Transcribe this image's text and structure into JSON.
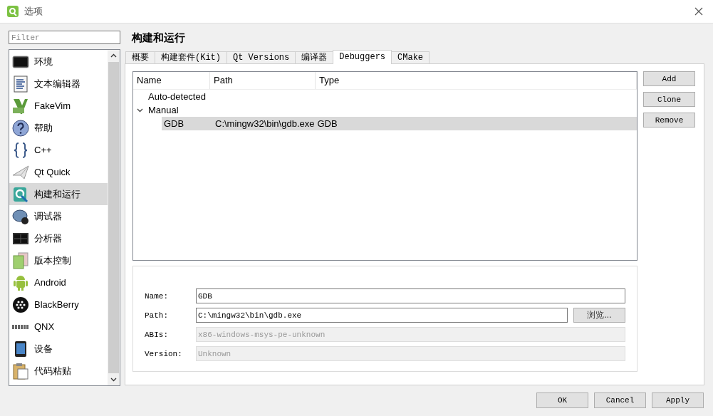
{
  "window": {
    "title": "选项"
  },
  "filter": {
    "placeholder": "Filter"
  },
  "sidebar": {
    "items": [
      {
        "label": "环境",
        "kind": "monitor",
        "selected": false
      },
      {
        "label": "文本编辑器",
        "kind": "document",
        "selected": false
      },
      {
        "label": "FakeVim",
        "kind": "vim",
        "selected": false
      },
      {
        "label": "帮助",
        "kind": "help",
        "selected": false
      },
      {
        "label": "C++",
        "kind": "braces",
        "selected": false
      },
      {
        "label": "Qt Quick",
        "kind": "plane",
        "selected": false
      },
      {
        "label": "构建和运行",
        "kind": "build",
        "selected": true
      },
      {
        "label": "调试器",
        "kind": "bug",
        "selected": false
      },
      {
        "label": "分析器",
        "kind": "scope",
        "selected": false
      },
      {
        "label": "版本控制",
        "kind": "files",
        "selected": false
      },
      {
        "label": "Android",
        "kind": "robot",
        "selected": false
      },
      {
        "label": "BlackBerry",
        "kind": "berry",
        "selected": false
      },
      {
        "label": "QNX",
        "kind": "qnx",
        "selected": false
      },
      {
        "label": "设备",
        "kind": "tablet",
        "selected": false
      },
      {
        "label": "代码粘贴",
        "kind": "clipboard",
        "selected": false
      }
    ]
  },
  "page_title": "构建和运行",
  "tabs": [
    {
      "label": "概要",
      "selected": false
    },
    {
      "label": "构建套件(Kit)",
      "selected": false
    },
    {
      "label": "Qt Versions",
      "selected": false
    },
    {
      "label": "编译器",
      "selected": false
    },
    {
      "label": "Debuggers",
      "selected": true
    },
    {
      "label": "CMake",
      "selected": false
    }
  ],
  "debuggers": {
    "columns": [
      "Name",
      "Path",
      "Type"
    ],
    "groups": [
      {
        "label": "Auto-detected"
      },
      {
        "label": "Manual",
        "expanded": true,
        "children": [
          {
            "name": "GDB",
            "path": "C:\\mingw32\\bin\\gdb.exe",
            "type": "GDB",
            "selected": true
          }
        ]
      }
    ]
  },
  "side_buttons": [
    "Add",
    "Clone",
    "Remove"
  ],
  "details": {
    "fields": [
      {
        "label": "Name:",
        "value": "GDB",
        "disabled": false
      },
      {
        "label": "Path:",
        "value": "C:\\mingw32\\bin\\gdb.exe",
        "disabled": false,
        "button": "浏览..."
      },
      {
        "label": "ABIs:",
        "value": "x86-windows-msys-pe-unknown",
        "disabled": true
      },
      {
        "label": "Version:",
        "value": "Unknown",
        "disabled": true
      }
    ]
  },
  "buttons": [
    "OK",
    "Cancel",
    "Apply"
  ]
}
